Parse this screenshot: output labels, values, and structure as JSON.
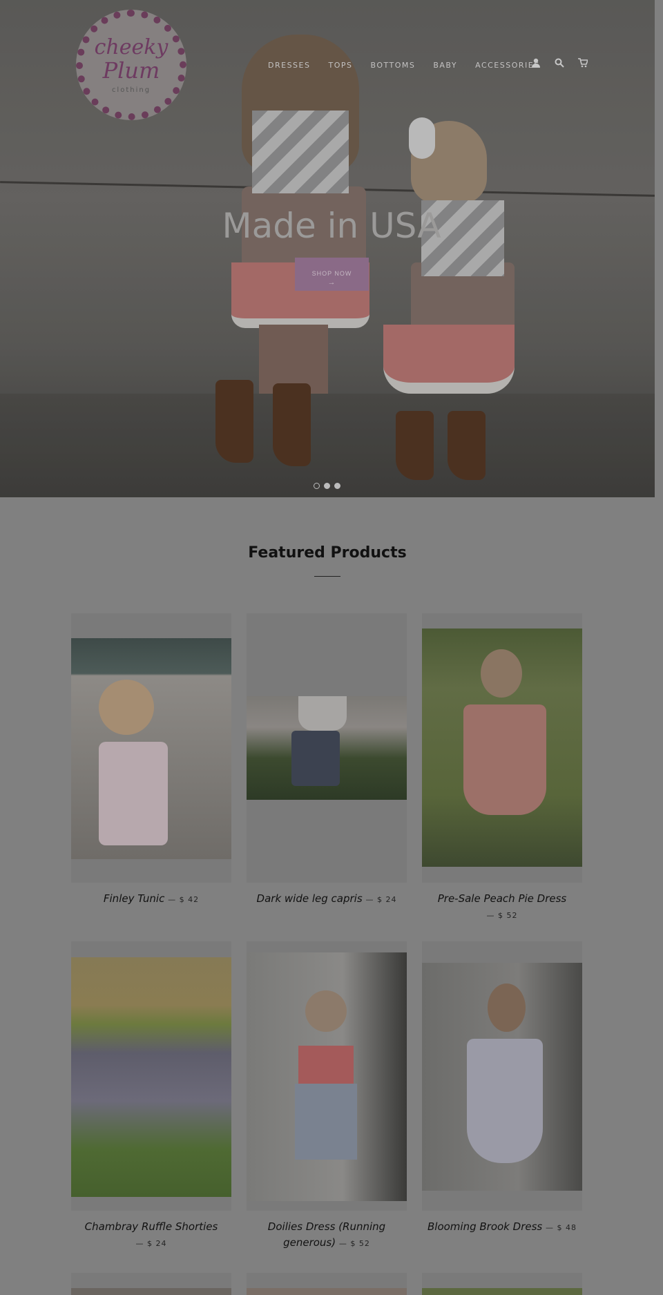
{
  "brand": {
    "line1": "cheeky",
    "line2": "Plum",
    "line3": "clothing"
  },
  "nav": {
    "items": [
      "DRESSES",
      "TOPS",
      "BOTTOMS",
      "BABY",
      "ACCESSORIES"
    ],
    "icons": [
      "account-icon",
      "search-icon",
      "cart-icon"
    ]
  },
  "hero": {
    "title": "Made in USA",
    "button": "SHOP NOW",
    "button_arrow": "→",
    "slides": 3,
    "active_slide": 1
  },
  "featured": {
    "title": "Featured Products",
    "products": [
      {
        "name": "Finley Tunic",
        "sep": "—",
        "price": "$ 42"
      },
      {
        "name": "Dark wide leg capris",
        "sep": "—",
        "price": "$ 24"
      },
      {
        "name": "Pre-Sale Peach Pie Dress",
        "sep": "—",
        "price": "$ 52"
      },
      {
        "name": "Chambray Ruffle Shorties",
        "sep": "—",
        "price": "$ 24"
      },
      {
        "name": "Doilies Dress (Running generous)",
        "sep": "—",
        "price": "$ 52"
      },
      {
        "name": "Blooming Brook Dress",
        "sep": "—",
        "price": "$ 48"
      }
    ]
  }
}
